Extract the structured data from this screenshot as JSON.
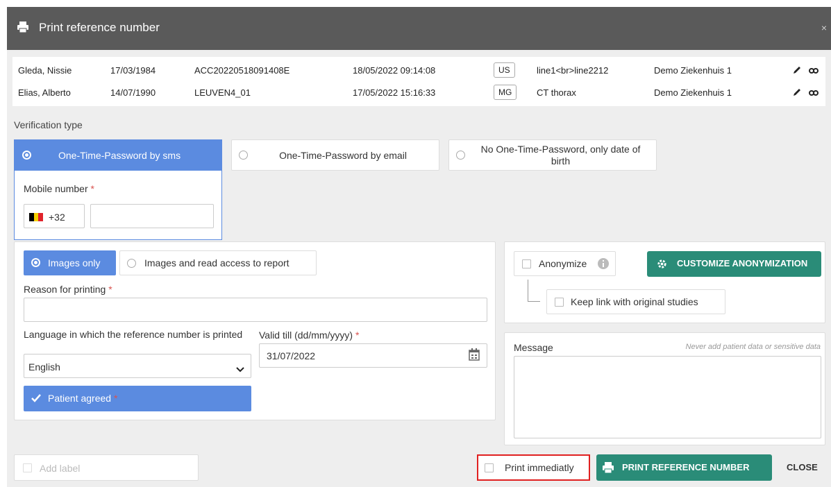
{
  "dialog": {
    "title": "Print reference number",
    "close_glyph": "×"
  },
  "studies": [
    {
      "name": "Gleda, Nissie",
      "dob": "17/03/1984",
      "accession": "ACC20220518091408E",
      "datetime": "18/05/2022 09:14:08",
      "modality": "US",
      "description": "line1<br>line2212",
      "institution": "Demo Ziekenhuis 1"
    },
    {
      "name": "Elias, Alberto",
      "dob": "14/07/1990",
      "accession": "LEUVEN4_01",
      "datetime": "17/05/2022 15:16:33",
      "modality": "MG",
      "description": "CT thorax",
      "institution": "Demo Ziekenhuis 1"
    }
  ],
  "verification": {
    "label": "Verification type",
    "options": [
      "One-Time-Password by sms",
      "One-Time-Password by email",
      "No One-Time-Password, only date of birth"
    ],
    "selected": "One-Time-Password by sms",
    "mobile_label": "Mobile number",
    "required_mark": "*",
    "country_code": "+32",
    "mobile_value": ""
  },
  "print_options": {
    "scope_options": [
      "Images only",
      "Images and read access to report"
    ],
    "selected_scope": "Images only",
    "reason_label": "Reason for printing",
    "reason_value": "",
    "language_label": "Language in which the reference number is printed",
    "language_value": "English",
    "valid_till_label": "Valid till (dd/mm/yyyy)",
    "valid_till_value": "31/07/2022",
    "patient_agreed_label": "Patient agreed"
  },
  "anonymization": {
    "anonymize_label": "Anonymize",
    "customize_label": "CUSTOMIZE ANONYMIZATION",
    "keep_link_label": "Keep link with original studies"
  },
  "message": {
    "label": "Message",
    "hint": "Never add patient data or sensitive data",
    "value": ""
  },
  "footer": {
    "add_label_placeholder": "Add label",
    "print_immediately_label": "Print immediatly",
    "print_button_label": "PRINT REFERENCE NUMBER",
    "close_label": "CLOSE"
  },
  "colors": {
    "titlebar": "#5a5a5a",
    "accent_blue": "#5b8be0",
    "teal": "#2a8c78",
    "highlight_red": "#e02020"
  }
}
